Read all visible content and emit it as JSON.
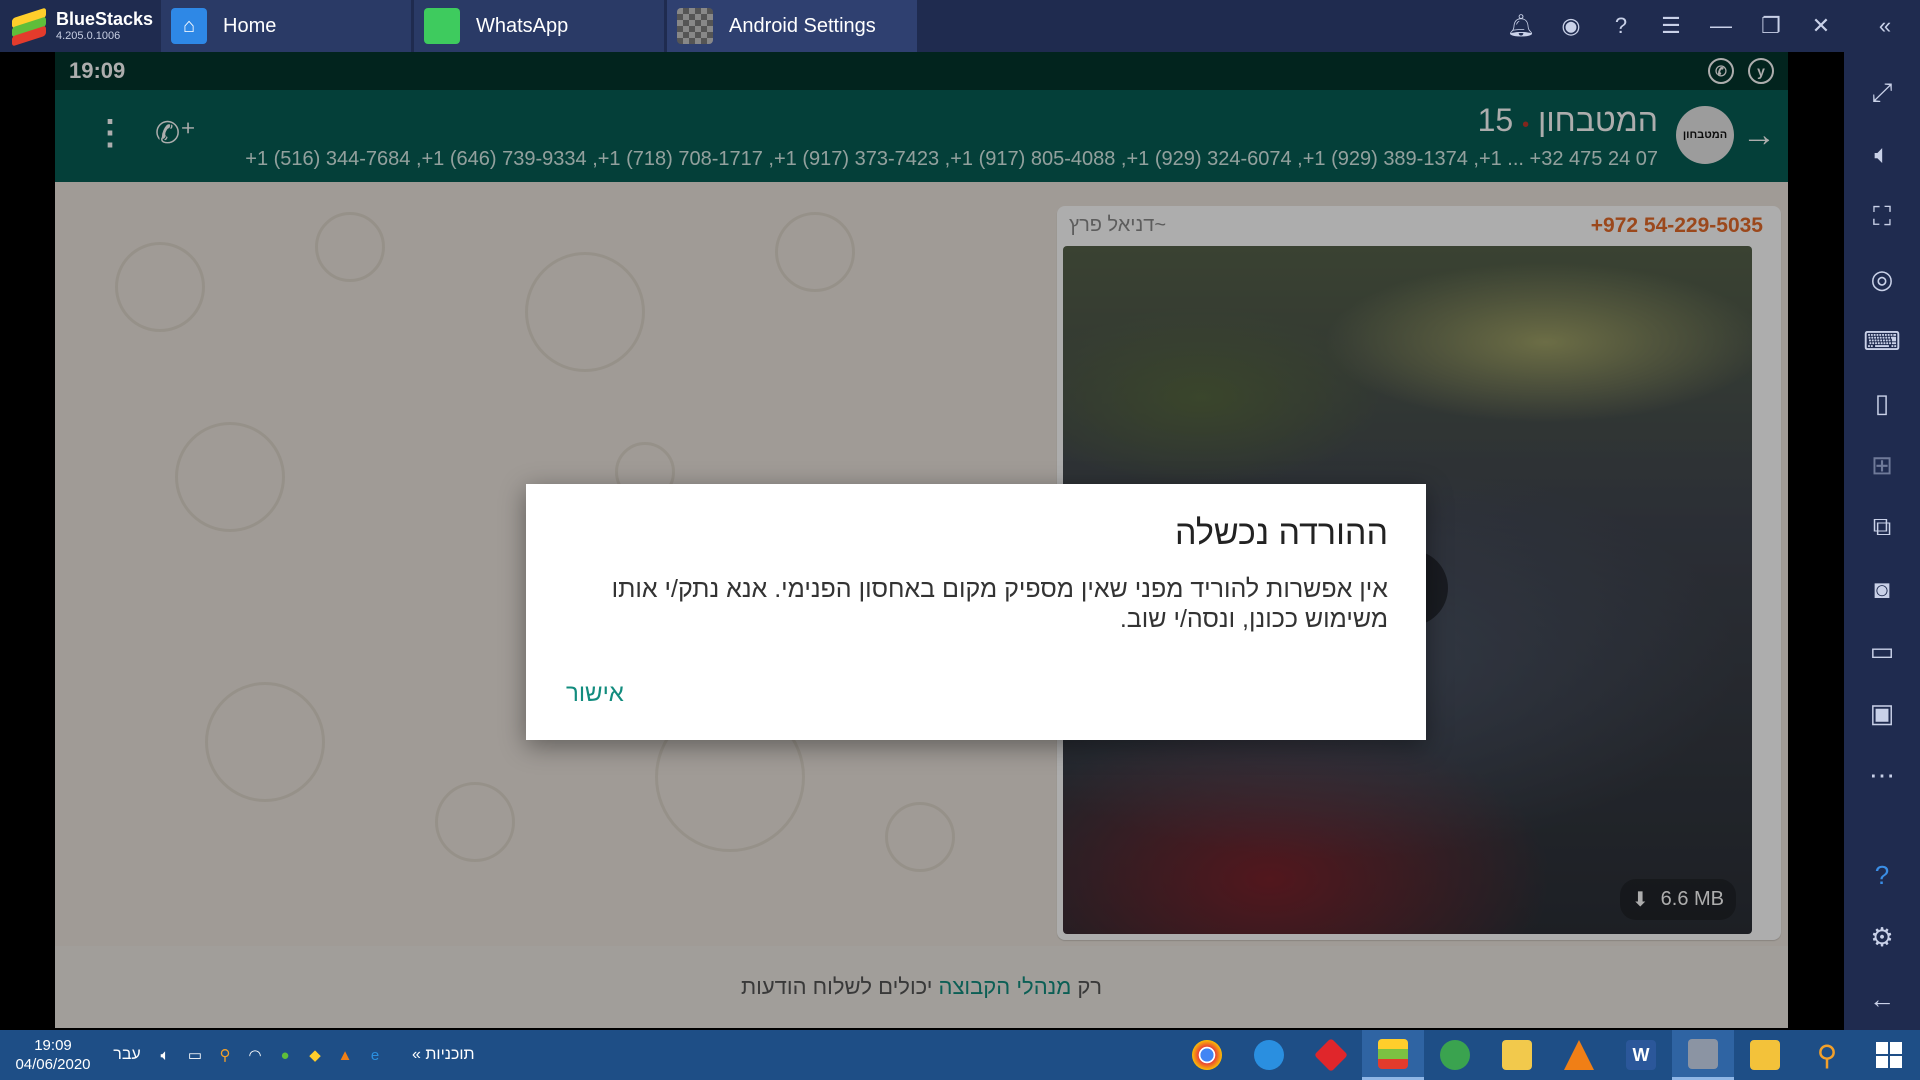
{
  "bluestacks": {
    "app_name": "BlueStacks",
    "version": "4.205.0.1006",
    "tabs": [
      {
        "label": "Home",
        "icon": "home-icon"
      },
      {
        "label": "WhatsApp",
        "icon": "whatsapp-app-icon"
      },
      {
        "label": "Android Settings",
        "icon": "settings-app-icon"
      }
    ],
    "controls": [
      "bell-icon",
      "account-icon",
      "help-icon",
      "menu-icon",
      "minimize-icon",
      "restore-icon",
      "close-icon",
      "collapse-sidebar-icon"
    ],
    "sidebar": [
      "fullscreen-icon",
      "volume-icon",
      "resize-icon",
      "eye-icon",
      "keyboard-icon",
      "rotate-icon",
      "gamepad-icon",
      "multi-instance-icon",
      "screenshot-icon",
      "video-record-icon",
      "media-icon",
      "more-icon",
      "help-icon",
      "settings-icon",
      "back-icon"
    ]
  },
  "android": {
    "status_time": "19:09",
    "status_icons": [
      "whatsapp-status-icon",
      "y-status-icon"
    ]
  },
  "chat": {
    "group_name": "המטבחון",
    "group_name_count": "15",
    "avatar_text": "המטבחון",
    "members": "+1 (516) 344-7684 ,+1 (646) 739-9334 ,+1 (718) 708-1717 ,+1 (917) 373-7423 ,+1 (917) 805-4088 ,+1 (929) 324-6074 ,+1 (929) 389-1374 ,+1 ... +32 475 24 07",
    "message": {
      "sender_phone": "+972 54-229-5035",
      "sender_name": "~דניאל פרץ",
      "file_size": "6.6 MB"
    },
    "footer_prefix": "רק",
    "footer_link": "מנהלי הקבוצה",
    "footer_suffix": "יכולים לשלוח הודעות"
  },
  "dialog": {
    "title": "ההורדה נכשלה",
    "body": "אין אפשרות להוריד מפני שאין מספיק מקום באחסון הפנימי. אנא נתק/י אותו משימוש ככונן, ונסה/י שוב.",
    "button": "אישור"
  },
  "taskbar": {
    "time": "19:09",
    "date": "04/06/2020",
    "lang": "עבר",
    "programs_label": "תוכניות",
    "expand": "«",
    "apps": [
      {
        "name": "chrome",
        "color": "#e94235"
      },
      {
        "name": "edge",
        "color": "#2a8fe0"
      },
      {
        "name": "red-app",
        "color": "#e0262b"
      },
      {
        "name": "bluestacks",
        "color": "#7cc142"
      },
      {
        "name": "globe-app",
        "color": "#3aa34f"
      },
      {
        "name": "folder-app",
        "color": "#f2c94c"
      },
      {
        "name": "vlc",
        "color": "#f07f16"
      },
      {
        "name": "word",
        "color": "#2b579a"
      },
      {
        "name": "camera-app",
        "color": "#8b94a3"
      },
      {
        "name": "explorer",
        "color": "#f3c23a"
      },
      {
        "name": "search",
        "color": "#f3a02a"
      },
      {
        "name": "windows",
        "color": "#ffffff"
      }
    ]
  }
}
